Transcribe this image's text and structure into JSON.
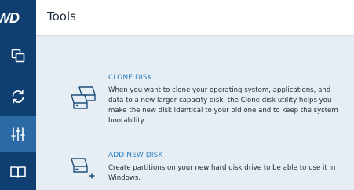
{
  "app": {
    "logo_text": "WD",
    "title": "Tools"
  },
  "sidebar": {
    "items": [
      {
        "name": "copy",
        "icon": "copy-icon",
        "active": false
      },
      {
        "name": "sync",
        "icon": "sync-icon",
        "active": false
      },
      {
        "name": "tools",
        "icon": "sliders-icon",
        "active": true
      },
      {
        "name": "guide",
        "icon": "book-icon",
        "active": false
      }
    ]
  },
  "tools": [
    {
      "title": "CLONE DISK",
      "description": "When you want to clone your operating system, applications, and data to a new larger capacity disk, the Clone disk utility helps you make the new disk identical to your old one and to keep the system bootability.",
      "icon": "clone-disk-icon"
    },
    {
      "title": "ADD NEW DISK",
      "description": "Create partitions on your new hard disk drive to be able to use it in Windows.",
      "icon": "add-disk-icon"
    }
  ],
  "colors": {
    "sidebar": "#0f3f70",
    "active": "#2c6aa6",
    "accent": "#2a7fc1",
    "background": "#e6edf3"
  }
}
